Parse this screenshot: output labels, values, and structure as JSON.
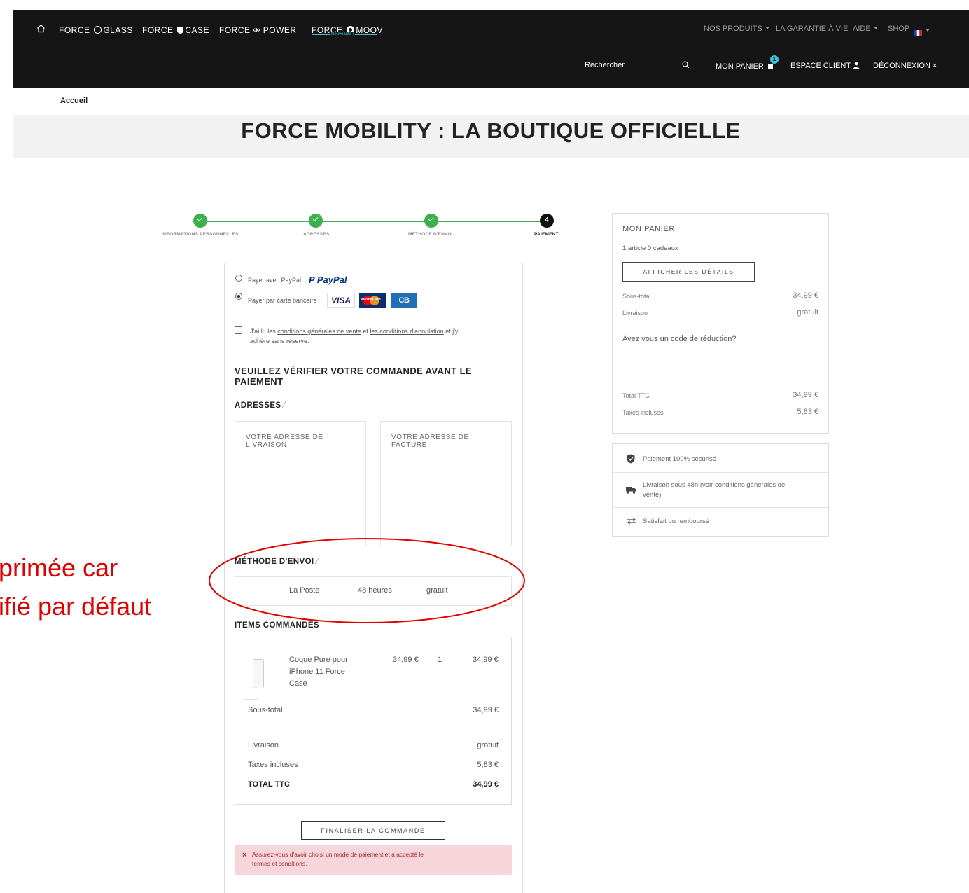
{
  "header": {
    "brands": [
      "FORCE",
      "GLASS",
      "FORCE",
      "CASE",
      "FORCE",
      "POWER",
      "FORCE",
      "MOOV"
    ],
    "brand_badge": "Nouveauté !",
    "nav_right": [
      "NOS PRODUITS",
      "LA GARANTIE À VIE",
      "AIDE",
      "SHOP"
    ],
    "search_placeholder": "Rechercher",
    "cart_label": "MON PANIER",
    "cart_count": "1",
    "account_label": "ESPACE CLIENT",
    "logout_label": "DÉCONNEXION"
  },
  "breadcrumb": "Accueil",
  "page_title": "FORCE MOBILITY : LA BOUTIQUE OFFICIELLE",
  "steps": [
    {
      "label": "INFORMATIONS PERSONNELLES",
      "status": "done"
    },
    {
      "label": "ADRESSES",
      "status": "done"
    },
    {
      "label": "MÉTHODE D'ENVOI",
      "status": "done"
    },
    {
      "label": "PAIEMENT",
      "status": "current",
      "number": "4"
    }
  ],
  "payment": {
    "paypal_label": "Payer avec PayPal",
    "paypal_logo_p": "P",
    "paypal_logo_text": "PayPal",
    "card_label": "Payer par carte bancaire",
    "card_logos": [
      "VISA",
      "MasterCard",
      "CB"
    ],
    "selected": "card"
  },
  "terms": {
    "prefix": "J'ai lu les",
    "link1": "conditions générales de vente",
    "mid": "et",
    "link2": "les conditions d'annulation",
    "suffix1": "et j'y",
    "suffix2": "adhère sans réserve."
  },
  "verify": {
    "heading_line1": "VEUILLEZ VÉRIFIER VOTRE COMMANDE AVANT LE",
    "heading_line2": "PAIEMENT"
  },
  "addresses": {
    "heading": "ADRESSES",
    "delivery_line1": "VOTRE ADRESSE DE",
    "delivery_line2": "LIVRAISON",
    "billing_line1": "VOTRE ADRESSE DE",
    "billing_line2": "FACTURE"
  },
  "shipping": {
    "heading": "MÉTHODE D'ENVOI",
    "carrier": "La Poste",
    "delay": "48 heures",
    "price": "gratuit"
  },
  "items": {
    "heading": "ITEMS COMMANDÉS",
    "list": [
      {
        "name_line1": "Coque Pure pour",
        "name_line2": "iPhone 11 Force",
        "name_line3": "Case",
        "unit_price": "34,99 €",
        "qty": "1",
        "total": "34,99 €"
      }
    ],
    "subtotal_label": "Sous-total",
    "subtotal_value": "34,99 €",
    "shipping_label": "Livraison",
    "shipping_value": "gratuit",
    "taxes_label": "Taxes incluses",
    "taxes_value": "5,83 €",
    "total_label": "TOTAL TTC",
    "total_value": "34,99 €"
  },
  "finalize_button": "FINALISER LA COMMANDE",
  "error": {
    "line1": "Assurez-vous d'avoir choisi un mode de paiement et a accepté le",
    "line2": "termes et conditions."
  },
  "cart_summary": {
    "title": "MON PANIER",
    "count_text": "1 article 0 cadeaux",
    "details_button": "AFFICHER LES DÉTAILS",
    "subtotal_label": "Sous-total",
    "subtotal_value": "34,99 €",
    "shipping_label": "Livraison",
    "shipping_value": "gratuit",
    "promo_text": "Avez vous un code de réduction?",
    "total_label": "Total TTC",
    "total_value": "34,99 €",
    "taxes_label": "Taxes incluses",
    "taxes_value": "5,83 €"
  },
  "reassurance": [
    {
      "icon": "shield-check-icon",
      "line1": "Paiement 100% sécurisé",
      "line2": ""
    },
    {
      "icon": "truck-icon",
      "line1": "Livraison sous 48h (voir conditions générales de",
      "line2": "vente)"
    },
    {
      "icon": "exchange-arrows-icon",
      "line1": "Satisfait ou remboursé",
      "line2": ""
    }
  ],
  "annotation": {
    "line1": "primée car",
    "line2": "ifié par défaut",
    "color": "#e00000"
  }
}
